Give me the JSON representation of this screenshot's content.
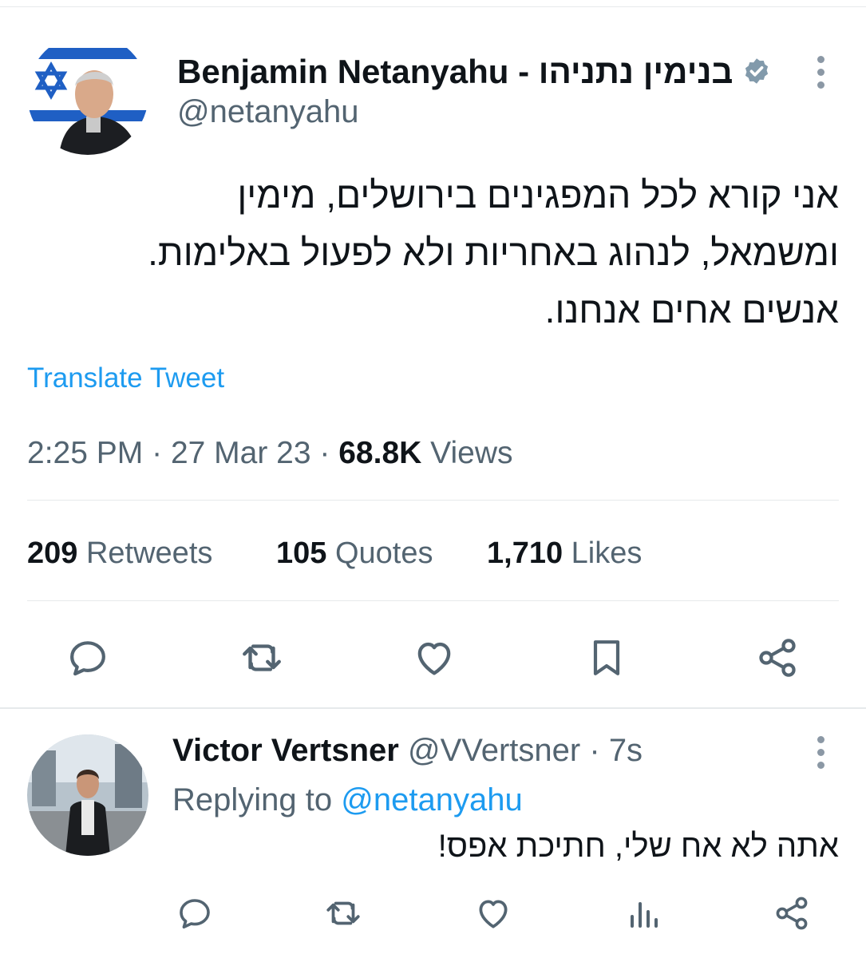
{
  "tweet": {
    "author_name": "Benjamin Netanyahu - בנימין נתניהו",
    "handle": "@netanyahu",
    "text_lines": [
      "אני קורא לכל המפגינים בירושלים, מימין",
      "ומשמאל, לנהוג באחריות ולא לפעול באלימות.",
      "אנשים אחים אנחנו."
    ],
    "translate_label": "Translate Tweet",
    "time": "2:25 PM",
    "date": "27 Mar 23",
    "views_count": "68.8K",
    "views_label": "Views",
    "retweets_count": "209",
    "retweets_label": "Retweets",
    "quotes_count": "105",
    "quotes_label": "Quotes",
    "likes_count": "1,710",
    "likes_label": "Likes",
    "sep": "·"
  },
  "reply": {
    "author_name": "Victor Vertsner",
    "handle": "@VVertsner",
    "age": "7s",
    "replying_to_label": "Replying to",
    "replying_to_handle": "@netanyahu",
    "text": "אתה לא אח שלי, חתיכת אפס!"
  },
  "icons": {
    "main_actions": [
      "reply-icon",
      "retweet-icon",
      "like-icon",
      "bookmark-icon",
      "share-icon"
    ],
    "reply_actions": [
      "reply-icon",
      "retweet-icon",
      "like-icon",
      "views-icon",
      "share-icon"
    ]
  },
  "colors": {
    "link": "#1d9bf0",
    "secondary_text": "#536471",
    "verified_badge": "#829aab",
    "icon": "#536471"
  }
}
